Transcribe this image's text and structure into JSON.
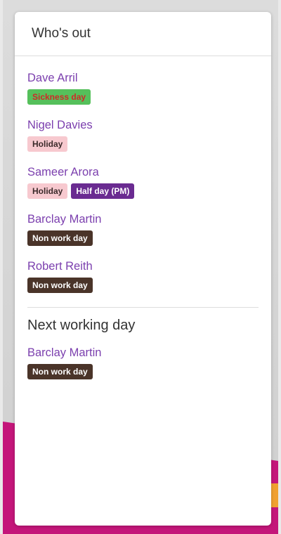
{
  "panel": {
    "title": "Who's out"
  },
  "people": [
    {
      "name": "Dave Arril",
      "badges": [
        {
          "label": "Sickness day",
          "type": "sickness"
        }
      ]
    },
    {
      "name": "Nigel Davies",
      "badges": [
        {
          "label": "Holiday",
          "type": "holiday"
        }
      ]
    },
    {
      "name": "Sameer Arora",
      "badges": [
        {
          "label": "Holiday",
          "type": "holiday"
        },
        {
          "label": "Half day (PM)",
          "type": "halfday"
        }
      ]
    },
    {
      "name": "Barclay Martin",
      "badges": [
        {
          "label": "Non work day",
          "type": "nonwork"
        }
      ]
    },
    {
      "name": "Robert Reith",
      "badges": [
        {
          "label": "Non work day",
          "type": "nonwork"
        }
      ]
    }
  ],
  "next_working_day": {
    "title": "Next working day",
    "people": [
      {
        "name": "Barclay Martin",
        "badges": [
          {
            "label": "Non work day",
            "type": "nonwork"
          }
        ]
      }
    ]
  },
  "colors": {
    "name_link": "#7b3fae",
    "sickness_bg": "#55c05b",
    "sickness_text": "#d02828",
    "holiday_bg": "#f7c9cf",
    "halfday_bg": "#6a2b91",
    "nonwork_bg": "#4a3429",
    "accent_magenta": "#c4167a",
    "accent_orange": "#f0a030"
  }
}
